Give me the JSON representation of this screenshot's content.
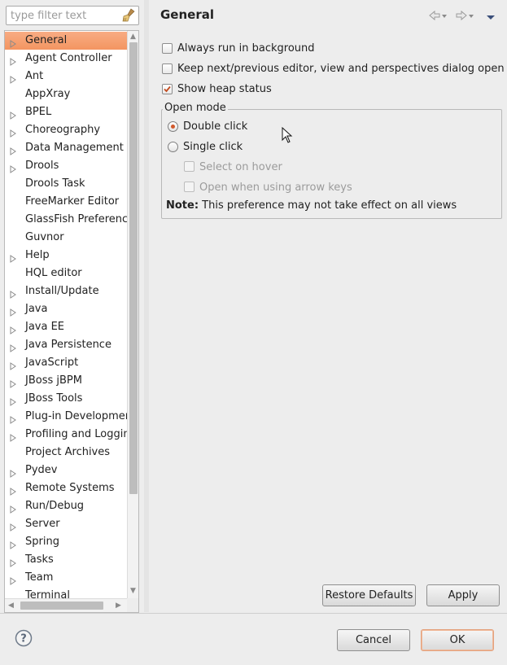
{
  "filter": {
    "placeholder": "type filter text"
  },
  "tree": {
    "items": [
      {
        "label": "General",
        "expandable": true,
        "selected": true
      },
      {
        "label": "Agent Controller",
        "expandable": true
      },
      {
        "label": "Ant",
        "expandable": true
      },
      {
        "label": "AppXray",
        "expandable": false
      },
      {
        "label": "BPEL",
        "expandable": true
      },
      {
        "label": "Choreography",
        "expandable": true
      },
      {
        "label": "Data Management",
        "expandable": true
      },
      {
        "label": "Drools",
        "expandable": true
      },
      {
        "label": "Drools Task",
        "expandable": false
      },
      {
        "label": "FreeMarker Editor",
        "expandable": false
      },
      {
        "label": "GlassFish Preferences",
        "expandable": false
      },
      {
        "label": "Guvnor",
        "expandable": false
      },
      {
        "label": "Help",
        "expandable": true
      },
      {
        "label": "HQL editor",
        "expandable": false
      },
      {
        "label": "Install/Update",
        "expandable": true
      },
      {
        "label": "Java",
        "expandable": true
      },
      {
        "label": "Java EE",
        "expandable": true
      },
      {
        "label": "Java Persistence",
        "expandable": true
      },
      {
        "label": "JavaScript",
        "expandable": true
      },
      {
        "label": "JBoss jBPM",
        "expandable": true
      },
      {
        "label": "JBoss Tools",
        "expandable": true
      },
      {
        "label": "Plug-in Development",
        "expandable": true
      },
      {
        "label": "Profiling and Logging",
        "expandable": true
      },
      {
        "label": "Project Archives",
        "expandable": false
      },
      {
        "label": "Pydev",
        "expandable": true
      },
      {
        "label": "Remote Systems",
        "expandable": true
      },
      {
        "label": "Run/Debug",
        "expandable": true
      },
      {
        "label": "Server",
        "expandable": true
      },
      {
        "label": "Spring",
        "expandable": true
      },
      {
        "label": "Tasks",
        "expandable": true
      },
      {
        "label": "Team",
        "expandable": true
      },
      {
        "label": "Terminal",
        "expandable": false
      }
    ]
  },
  "page": {
    "title": "General"
  },
  "options": {
    "always_run": {
      "label": "Always run in background",
      "checked": false
    },
    "keep_next_prev": {
      "label": "Keep next/previous editor, view and perspectives dialog open",
      "checked": false
    },
    "show_heap": {
      "label": "Show heap status",
      "checked": true
    }
  },
  "open_mode": {
    "title": "Open mode",
    "double_click": {
      "label": "Double click",
      "selected": true
    },
    "single_click": {
      "label": "Single click",
      "selected": false
    },
    "select_on_hover": {
      "label": "Select on hover",
      "enabled": false
    },
    "open_arrow_keys": {
      "label": "Open when using arrow keys",
      "enabled": false
    }
  },
  "note": {
    "prefix": "Note:",
    "text": " This preference may not take effect on all views"
  },
  "buttons": {
    "restore_defaults": "Restore Defaults",
    "apply": "Apply",
    "cancel": "Cancel",
    "ok": "OK"
  },
  "colors": {
    "selection": "#f39561",
    "radio_dot": "#d2592c",
    "ok_border": "#e3a27e"
  },
  "icons": {
    "clear_filter": "broom-icon",
    "back": "back-arrow-icon",
    "forward": "forward-arrow-icon",
    "view_menu": "view-menu-icon",
    "help": "help-icon"
  }
}
